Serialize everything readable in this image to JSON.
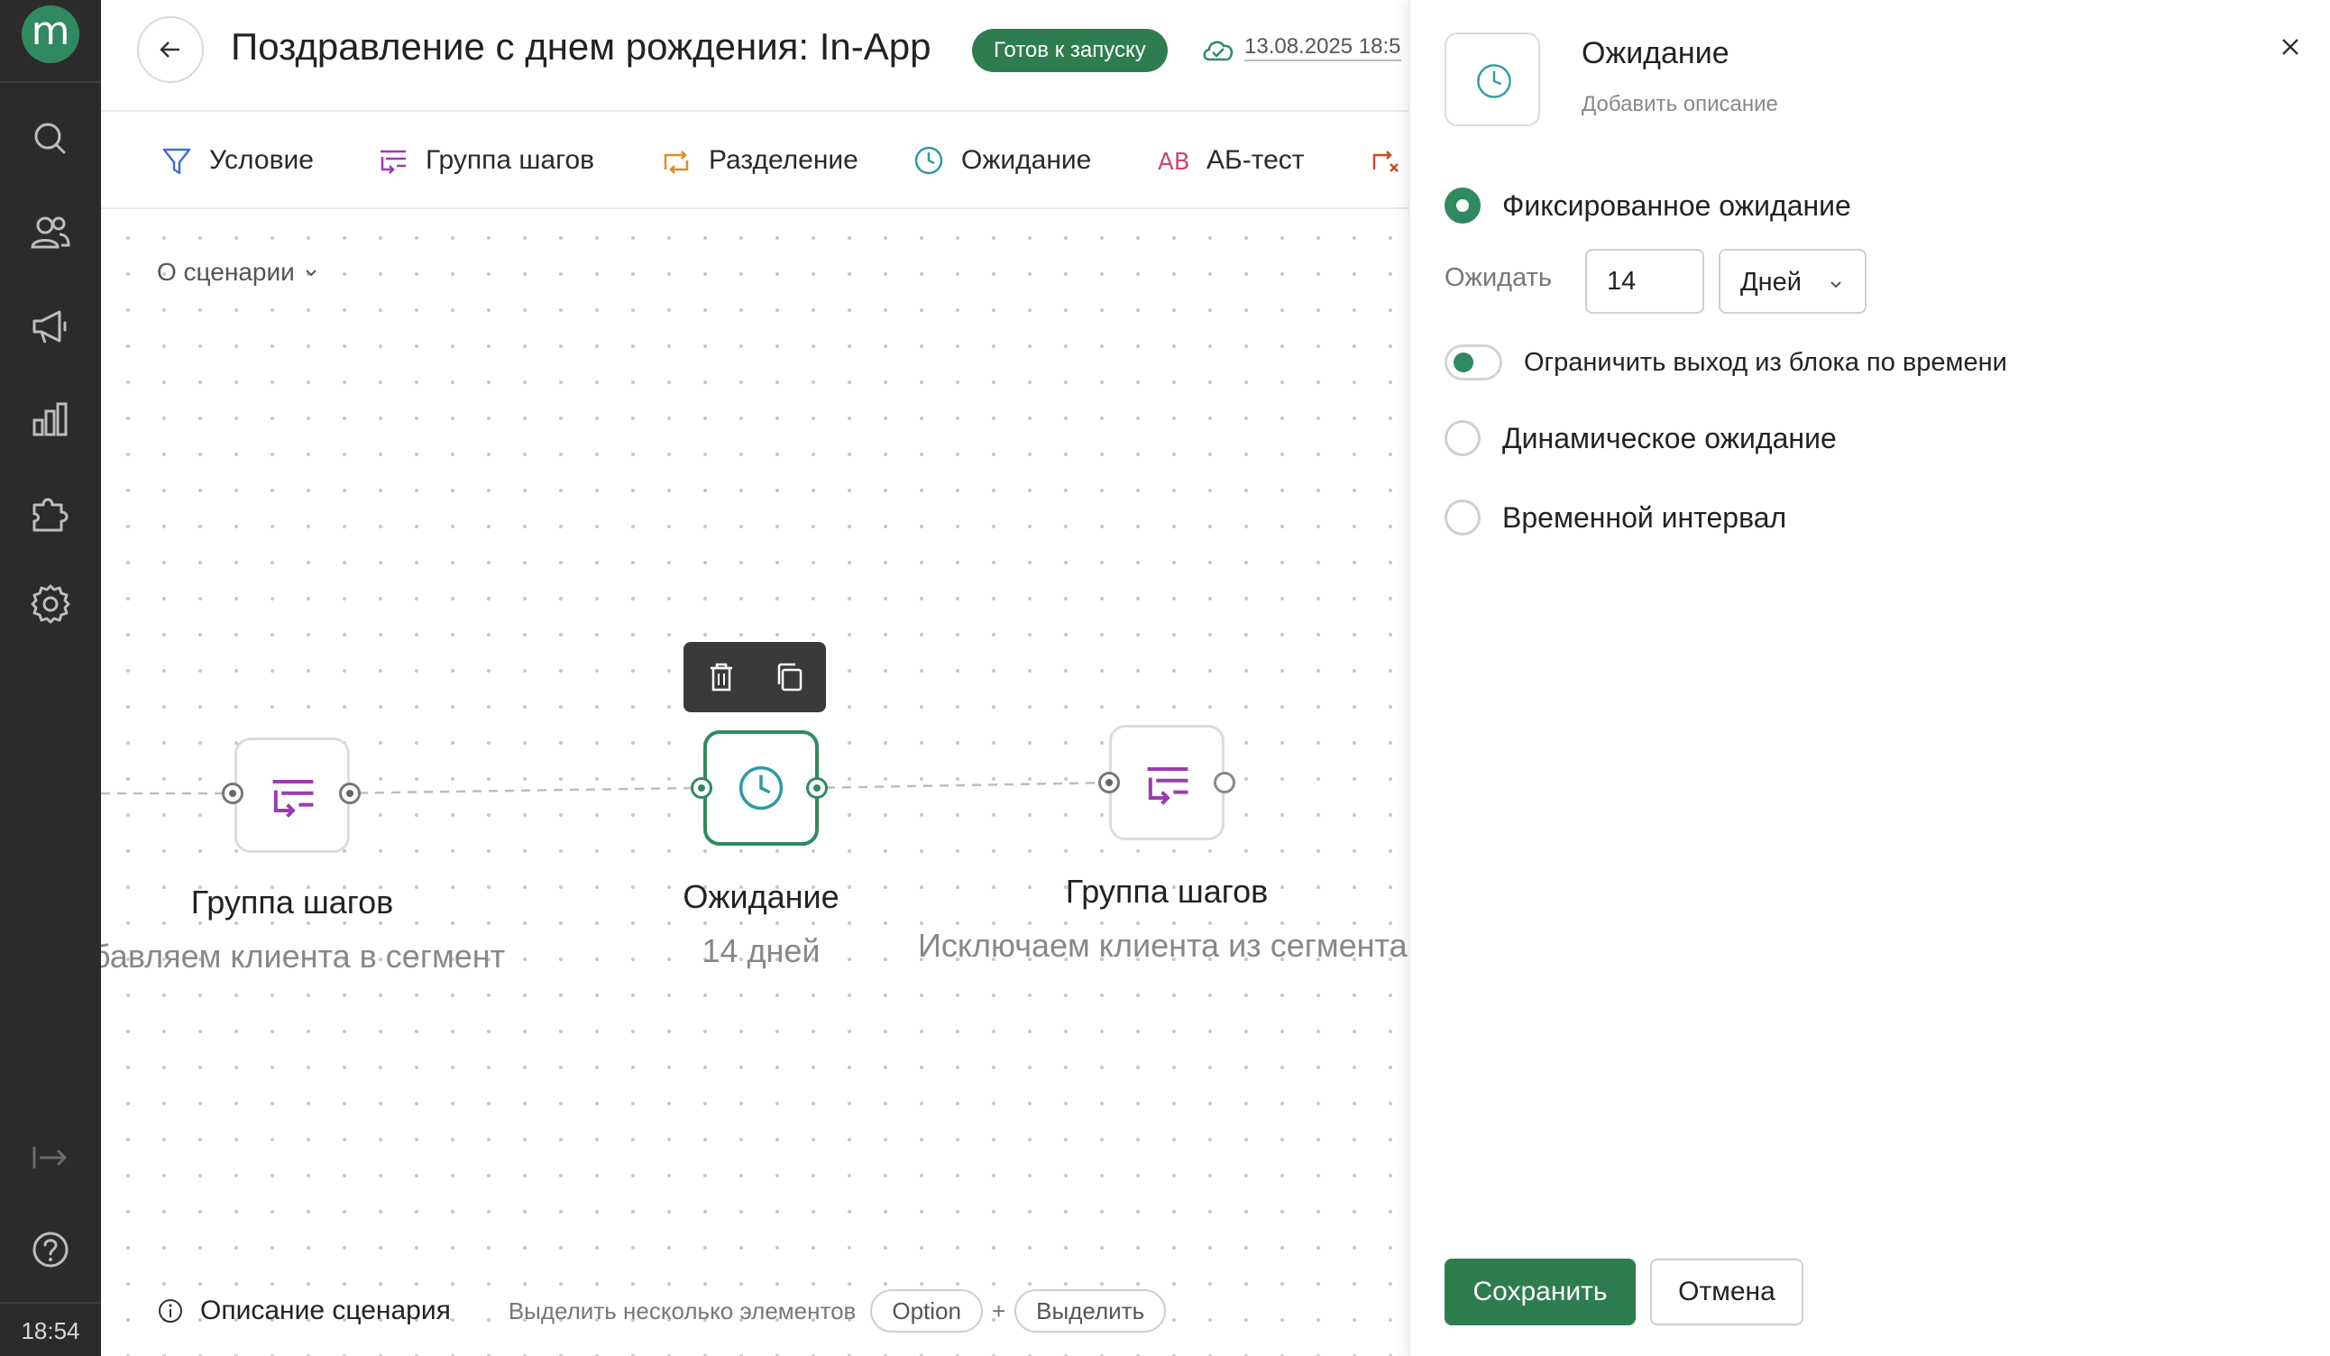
{
  "rail": {
    "logo_letter": "m",
    "items": [
      {
        "icon": "search-icon"
      },
      {
        "icon": "users-icon"
      },
      {
        "icon": "megaphone-icon"
      },
      {
        "icon": "chart-icon"
      },
      {
        "icon": "puzzle-icon"
      },
      {
        "icon": "gear-icon"
      }
    ],
    "bottom": [
      {
        "icon": "collapse-icon"
      },
      {
        "icon": "help-icon"
      }
    ],
    "clock": "18:54"
  },
  "header": {
    "title": "Поздравление с днем рождения: In-App",
    "status": "Готов к запуску",
    "saved_date": "13.08.2025 18:5"
  },
  "toolbar": {
    "items": [
      {
        "label": "Условие",
        "icon": "filter-icon"
      },
      {
        "label": "Группа шагов",
        "icon": "step-group-icon"
      },
      {
        "label": "Разделение",
        "icon": "split-icon"
      },
      {
        "label": "Ожидание",
        "icon": "clock-icon"
      },
      {
        "label": "АБ-тест",
        "icon": "ab-test-icon",
        "glyph": "AB"
      },
      {
        "label": "",
        "icon": "exit-icon"
      }
    ]
  },
  "canvas": {
    "about": "О сценарии",
    "nodes": [
      {
        "title": "Группа шагов",
        "subtitle": "бавляем клиента в сегмент"
      },
      {
        "title": "Ожидание",
        "subtitle": "14 дней"
      },
      {
        "title": "Группа шагов",
        "subtitle": "Исключаем клиента из сегмента"
      }
    ],
    "hint": {
      "description": "Описание сценария",
      "multi_select": "Выделить несколько элементов",
      "key1": "Option",
      "plus": "+",
      "key2": "Выделить"
    }
  },
  "panel": {
    "title": "Ожидание",
    "description_placeholder": "Добавить описание",
    "options": [
      {
        "label": "Фиксированное ожидание",
        "selected": true
      },
      {
        "label": "Динамическое ожидание",
        "selected": false
      },
      {
        "label": "Временной интервал",
        "selected": false
      }
    ],
    "wait_label": "Ожидать",
    "wait_value": "14",
    "wait_unit": "Дней",
    "limit_toggle_label": "Ограничить выход из блока по времени",
    "limit_toggle_on": true,
    "save": "Сохранить",
    "cancel": "Отмена"
  },
  "colors": {
    "accent": "#2e7d4f",
    "rail": "#2b2b2b",
    "step_group": "#9c3bb0",
    "wait": "#2e9aa6",
    "split": "#e08a2a",
    "ab": "#c94a6a",
    "filter": "#3a6fd8"
  }
}
